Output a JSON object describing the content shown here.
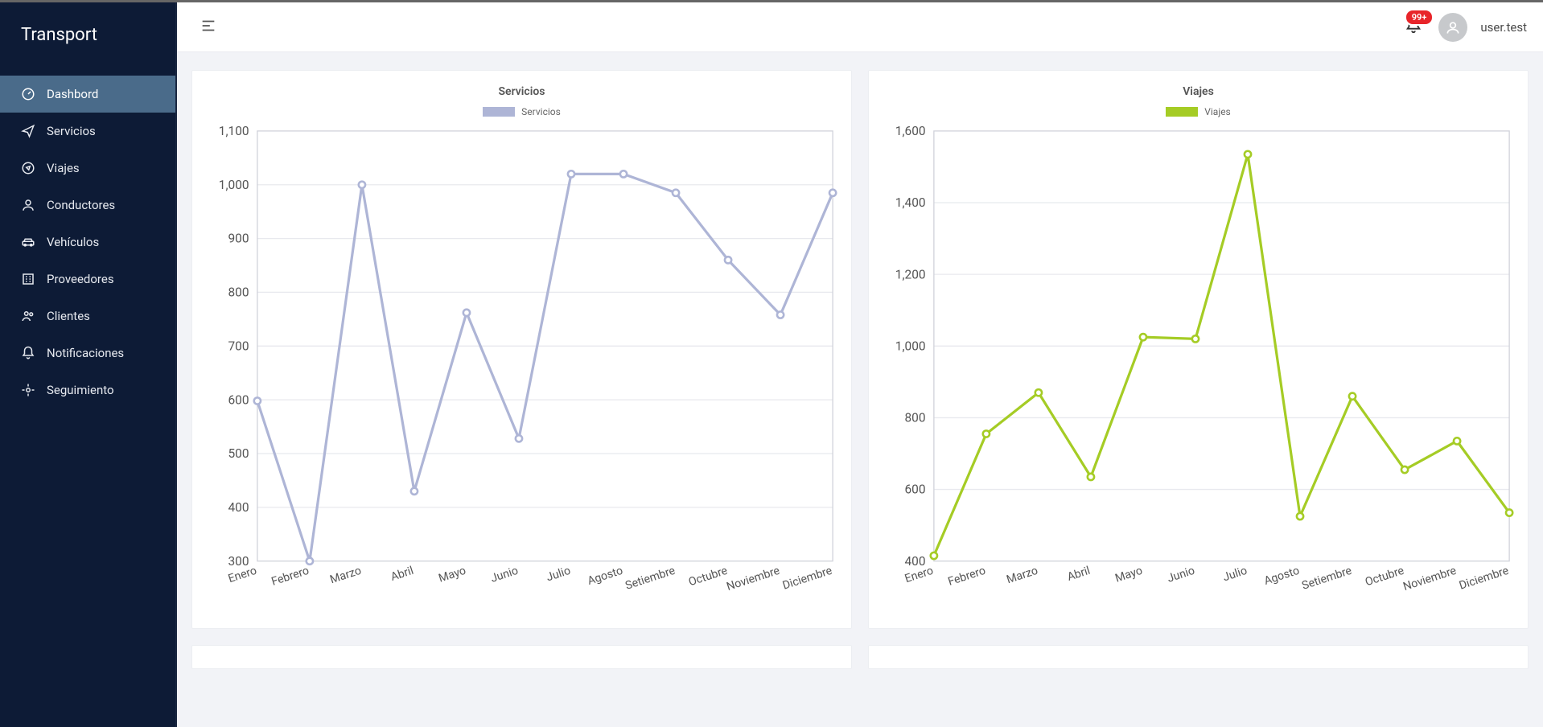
{
  "brand": "Transport",
  "sidebar": {
    "items": [
      {
        "label": "Dashbord",
        "active": true
      },
      {
        "label": "Servicios"
      },
      {
        "label": "Viajes"
      },
      {
        "label": "Conductores"
      },
      {
        "label": "Vehículos"
      },
      {
        "label": "Proveedores"
      },
      {
        "label": "Clientes"
      },
      {
        "label": "Notificaciones"
      },
      {
        "label": "Seguimiento"
      }
    ]
  },
  "topbar": {
    "notification_badge": "99+",
    "username": "user.test"
  },
  "charts": {
    "left": {
      "title": "Servicios",
      "legend": "Servicios",
      "color": "#aeb5d6"
    },
    "right": {
      "title": "Viajes",
      "legend": "Viajes",
      "color": "#a5cc25"
    }
  },
  "chart_data": [
    {
      "type": "line",
      "title": "Servicios",
      "series_name": "Servicios",
      "xlabel": "",
      "ylabel": "",
      "color": "#aeb5d6",
      "ylim": [
        300,
        1100
      ],
      "ystep": 100,
      "categories": [
        "Enero",
        "Febrero",
        "Marzo",
        "Abril",
        "Mayo",
        "Junio",
        "Julio",
        "Agosto",
        "Setiembre",
        "Octubre",
        "Noviembre",
        "Diciembre"
      ],
      "values": [
        598,
        300,
        1000,
        430,
        762,
        528,
        1020,
        1020,
        985,
        860,
        758,
        985
      ]
    },
    {
      "type": "line",
      "title": "Viajes",
      "series_name": "Viajes",
      "xlabel": "",
      "ylabel": "",
      "color": "#a5cc25",
      "ylim": [
        400,
        1600
      ],
      "ystep": 200,
      "categories": [
        "Enero",
        "Febrero",
        "Marzo",
        "Abril",
        "Mayo",
        "Junio",
        "Julio",
        "Agosto",
        "Setiembre",
        "Octubre",
        "Noviembre",
        "Diciembre"
      ],
      "values": [
        415,
        755,
        870,
        635,
        1025,
        1020,
        1535,
        525,
        860,
        655,
        735,
        535
      ]
    }
  ]
}
